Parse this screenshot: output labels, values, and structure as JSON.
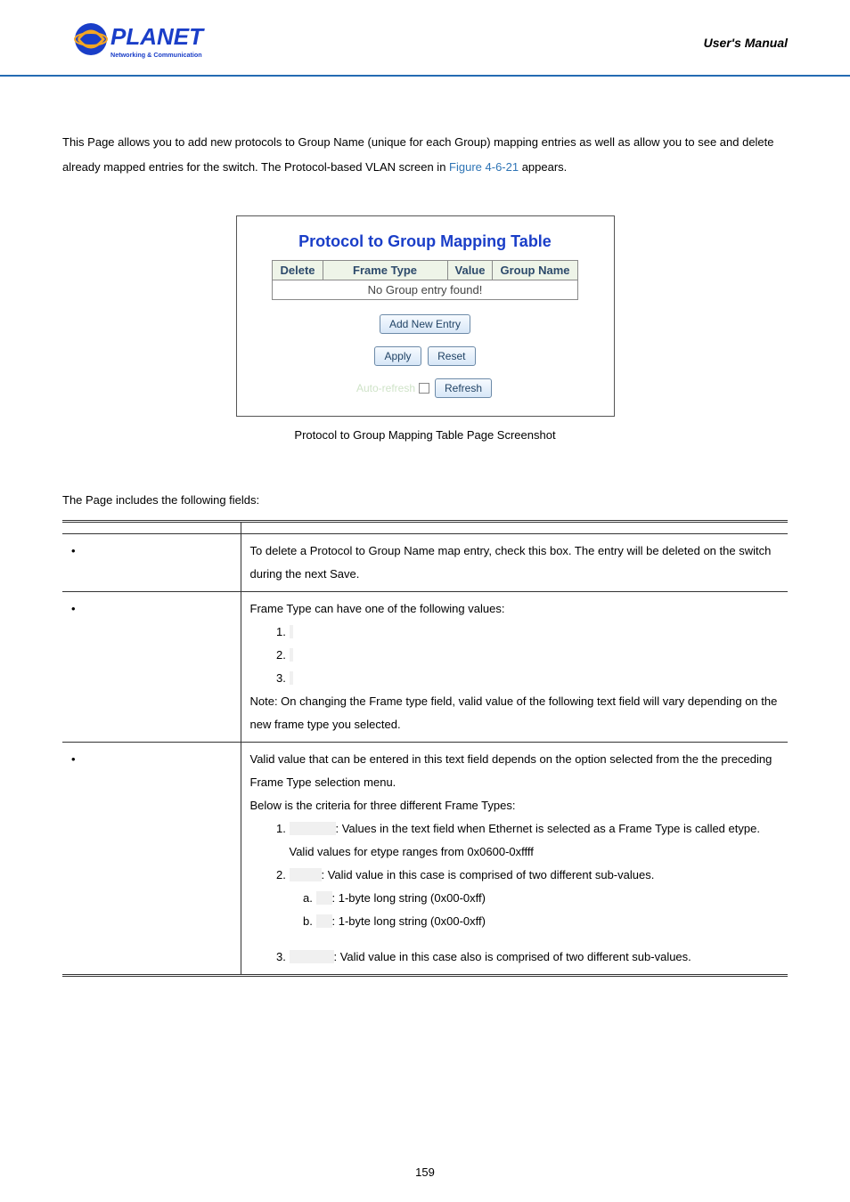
{
  "header": {
    "brand_top": "PLANET",
    "brand_sub": "Networking & Communication",
    "manual": "User's Manual"
  },
  "intro": {
    "text_before_link": "This Page allows you to add new protocols to Group Name (unique for each Group) mapping entries as well as allow you to see and delete already mapped entries for the switch. The Protocol-based VLAN screen in ",
    "link": "Figure 4-6-21",
    "text_after_link": " appears."
  },
  "figure": {
    "title": "Protocol to Group Mapping Table",
    "cols": [
      "Delete",
      "Frame Type",
      "Value",
      "Group Name"
    ],
    "no_entry": "No Group entry found!",
    "btn_add": "Add New Entry",
    "btn_apply": "Apply",
    "btn_reset": "Reset",
    "auto_refresh": "Auto-refresh",
    "btn_refresh": "Refresh",
    "caption": "Protocol to Group Mapping Table Page Screenshot"
  },
  "fields_intro": "The Page includes the following fields:",
  "table": {
    "header_obj": "",
    "header_desc": "",
    "rows": [
      {
        "label": "",
        "desc_lead": "To delete a Protocol to Group Name map entry, check this box. The entry will be deleted on the switch during the next Save."
      },
      {
        "label": "",
        "desc_lead": "Frame Type can have one of the following values:",
        "ol": [
          "",
          "",
          ""
        ],
        "note": "Note: On changing the Frame type field, valid value of the following text field will vary depending on the new frame type you selected."
      },
      {
        "label": "",
        "desc_lead": "Valid value that can be entered in this text field depends on the option selected from the the preceding Frame Type selection menu.",
        "criteria_lead": "Below is the criteria for three different Frame Types:",
        "criteria": [
          {
            "prefix": "",
            "text": ": Values in the text field when Ethernet is selected as a Frame Type is called etype. Valid values for etype ranges from 0x0600-0xffff"
          },
          {
            "prefix": "",
            "text": ": Valid value in this case is comprised of two different sub-values.",
            "sub": [
              {
                "prefix": "",
                "text": ": 1-byte long string (0x00-0xff)"
              },
              {
                "prefix": "",
                "text": ": 1-byte long string (0x00-0xff)"
              }
            ]
          },
          {
            "prefix": "",
            "text": ": Valid value in this case also is comprised of two different sub-values."
          }
        ]
      }
    ]
  },
  "page_number": "159"
}
